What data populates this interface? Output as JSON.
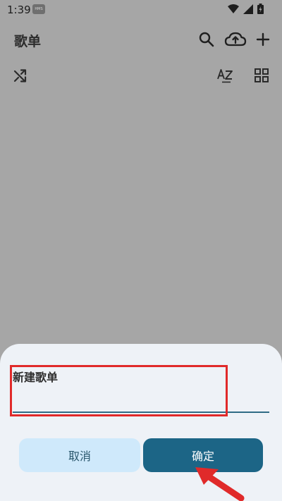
{
  "status_bar": {
    "time": "1:39",
    "app_badge": "HMS"
  },
  "header": {
    "title": "歌单",
    "icons": [
      "search-icon",
      "cloud-upload-icon",
      "add-icon"
    ]
  },
  "toolbar": {
    "icons": [
      "shuffle-icon",
      "sort-az-icon",
      "grid-view-icon"
    ]
  },
  "dialog": {
    "title": "新建歌单",
    "input_value": "",
    "cancel_label": "取消",
    "confirm_label": "确定"
  },
  "colors": {
    "scrim": "#a6a6a6",
    "sheet_bg": "#eef2f7",
    "input_underline": "#2f6b85",
    "cancel_bg": "#cfe9fb",
    "confirm_bg": "#1c6586",
    "annotation": "#e02a2a"
  }
}
